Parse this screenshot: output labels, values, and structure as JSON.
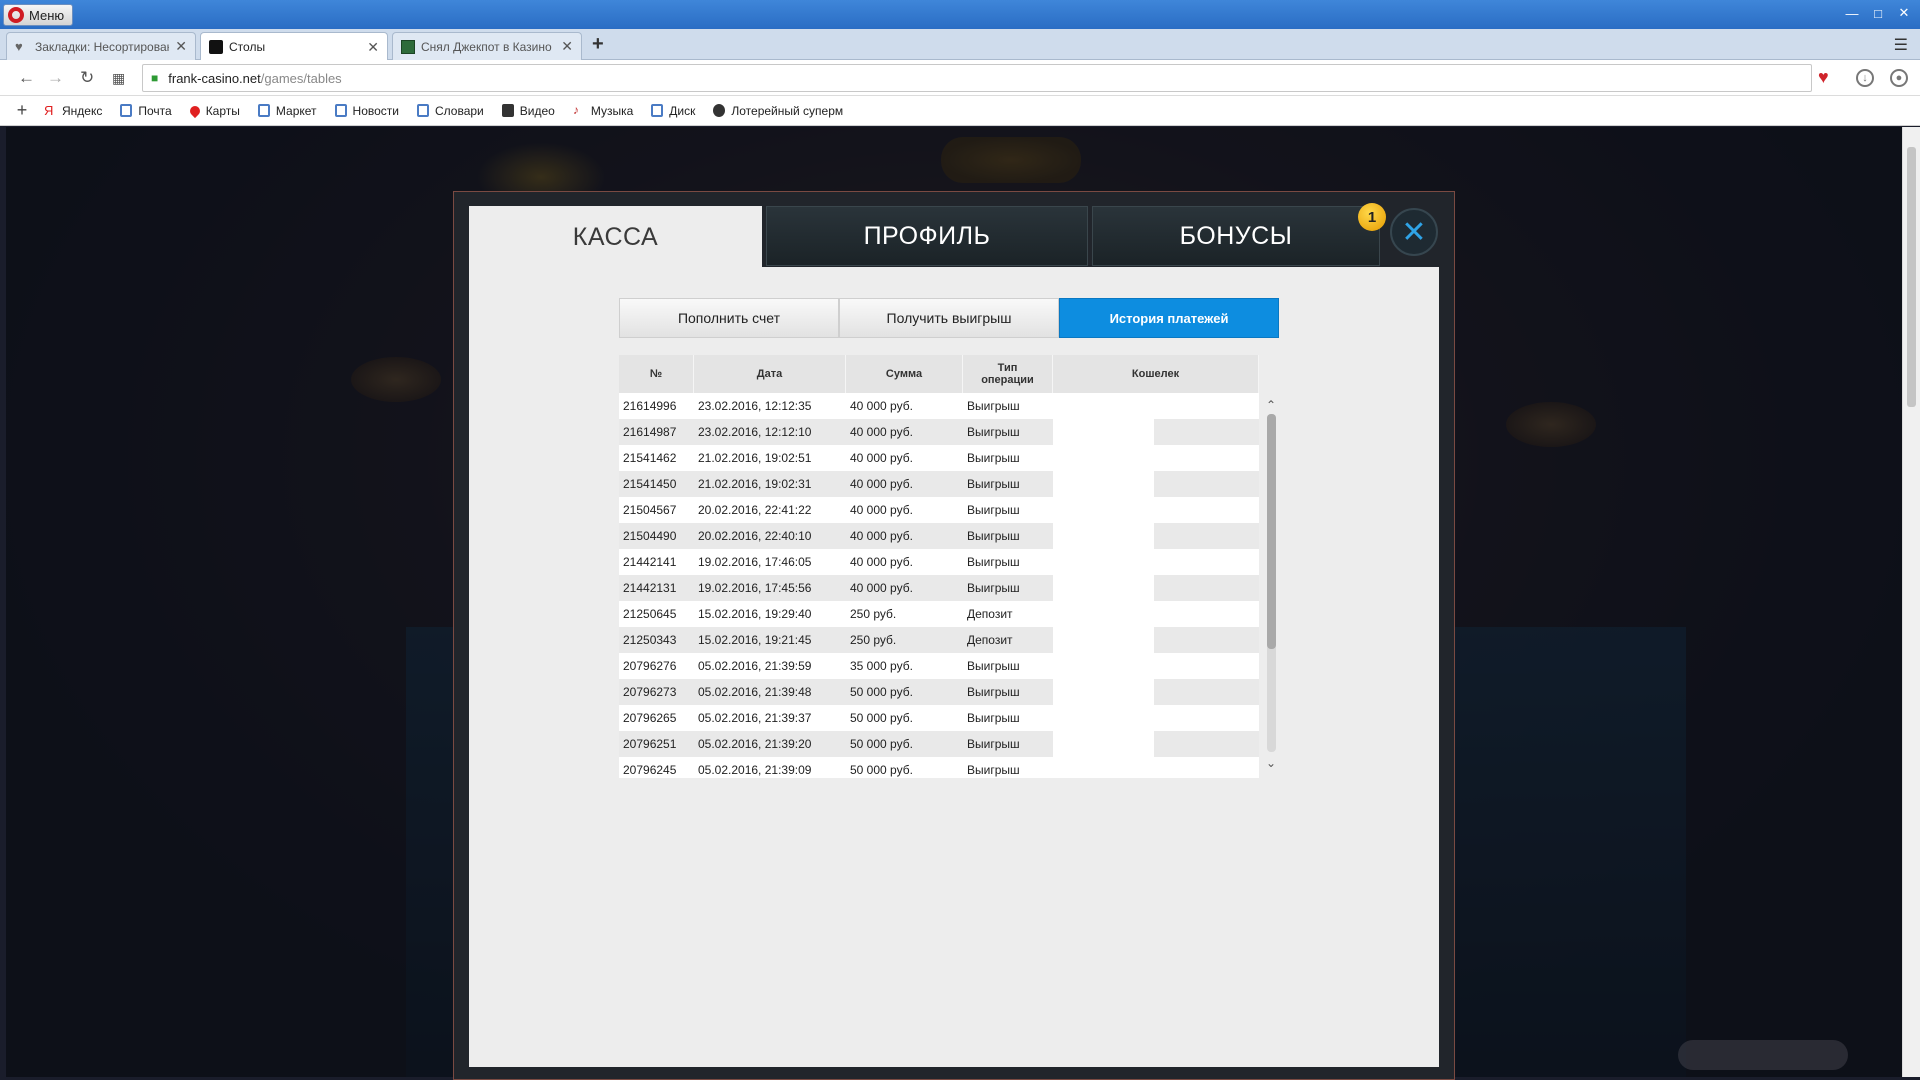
{
  "browser": {
    "menu_label": "Меню",
    "tabs": [
      {
        "title": "Закладки: Несортированные",
        "active": false
      },
      {
        "title": "Столы",
        "active": true
      },
      {
        "title": "Снял Джекпот в Казино Ф",
        "active": false
      }
    ],
    "url_domain": "frank-casino.net",
    "url_path": "/games/tables",
    "bookmarks": [
      "Яндекс",
      "Почта",
      "Карты",
      "Маркет",
      "Новости",
      "Словари",
      "Видео",
      "Музыка",
      "Диск",
      "Лотерейный суперм"
    ]
  },
  "modal": {
    "tabs": [
      "КАССА",
      "ПРОФИЛЬ",
      "БОНУСЫ"
    ],
    "active_tab": "КАССА",
    "notification_count": "1",
    "subtabs": [
      "Пополнить счет",
      "Получить выигрыш",
      "История платежей"
    ],
    "active_subtab": "История платежей",
    "table": {
      "headers": {
        "num": "№",
        "date": "Дата",
        "amount": "Сумма",
        "type_line1": "Тип",
        "type_line2": "операции",
        "wallet": "Кошелек"
      },
      "rows": [
        {
          "id": "21614996",
          "date": "23.02.2016, 12:12:35",
          "amount": "40 000 руб.",
          "type": "Выигрыш"
        },
        {
          "id": "21614987",
          "date": "23.02.2016, 12:12:10",
          "amount": "40 000 руб.",
          "type": "Выигрыш"
        },
        {
          "id": "21541462",
          "date": "21.02.2016, 19:02:51",
          "amount": "40 000 руб.",
          "type": "Выигрыш"
        },
        {
          "id": "21541450",
          "date": "21.02.2016, 19:02:31",
          "amount": "40 000 руб.",
          "type": "Выигрыш"
        },
        {
          "id": "21504567",
          "date": "20.02.2016, 22:41:22",
          "amount": "40 000 руб.",
          "type": "Выигрыш"
        },
        {
          "id": "21504490",
          "date": "20.02.2016, 22:40:10",
          "amount": "40 000 руб.",
          "type": "Выигрыш"
        },
        {
          "id": "21442141",
          "date": "19.02.2016, 17:46:05",
          "amount": "40 000 руб.",
          "type": "Выигрыш"
        },
        {
          "id": "21442131",
          "date": "19.02.2016, 17:45:56",
          "amount": "40 000 руб.",
          "type": "Выигрыш"
        },
        {
          "id": "21250645",
          "date": "15.02.2016, 19:29:40",
          "amount": "250 руб.",
          "type": "Депозит"
        },
        {
          "id": "21250343",
          "date": "15.02.2016, 19:21:45",
          "amount": "250 руб.",
          "type": "Депозит"
        },
        {
          "id": "20796276",
          "date": "05.02.2016, 21:39:59",
          "amount": "35 000 руб.",
          "type": "Выигрыш"
        },
        {
          "id": "20796273",
          "date": "05.02.2016, 21:39:48",
          "amount": "50 000 руб.",
          "type": "Выигрыш"
        },
        {
          "id": "20796265",
          "date": "05.02.2016, 21:39:37",
          "amount": "50 000 руб.",
          "type": "Выигрыш"
        },
        {
          "id": "20796251",
          "date": "05.02.2016, 21:39:20",
          "amount": "50 000 руб.",
          "type": "Выигрыш"
        },
        {
          "id": "20796245",
          "date": "05.02.2016, 21:39:09",
          "amount": "50 000 руб.",
          "type": "Выигрыш"
        }
      ]
    }
  },
  "colors": {
    "accent": "#0d8de0",
    "close_icon": "#2fa3e6",
    "badge": "#f2b10a",
    "opera_red": "#d01b22"
  }
}
